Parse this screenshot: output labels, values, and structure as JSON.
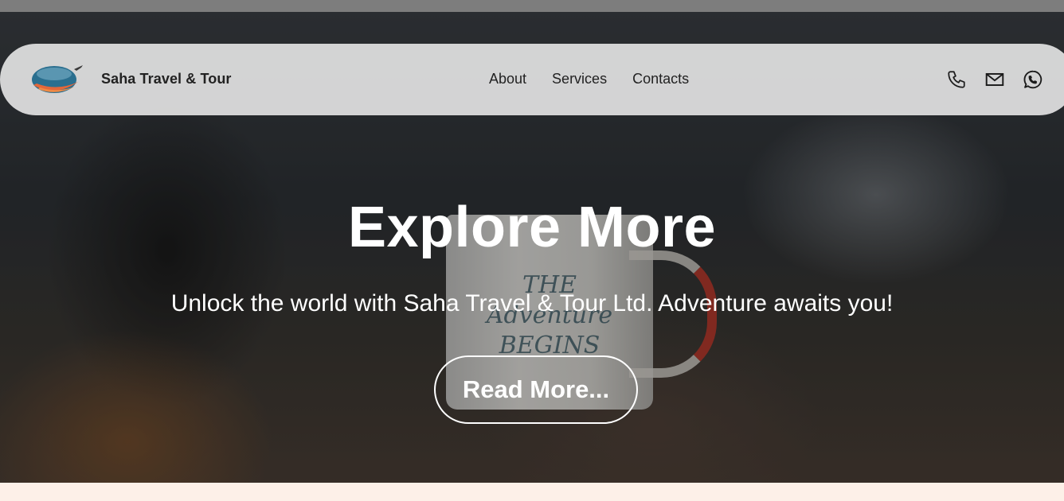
{
  "brand": {
    "name": "Saha Travel & Tour",
    "logo_icon": "globe-plane-logo"
  },
  "nav": {
    "links": [
      {
        "label": "About"
      },
      {
        "label": "Services"
      },
      {
        "label": "Contacts"
      }
    ],
    "icons": [
      "phone-icon",
      "mail-icon",
      "whatsapp-icon"
    ]
  },
  "hero": {
    "title": "Explore More",
    "subtitle": "Unlock the world with Saha Travel & Tour Ltd. Adventure awaits you!",
    "cta_label": "Read More...",
    "mug_text": "THE Adventure BEGINS"
  },
  "colors": {
    "top_strip": "#7d7d7d",
    "navbar_bg": "#f0f0f0",
    "text_dark": "#222222",
    "hero_text": "#ffffff",
    "bottom_band": "#fdf0e8",
    "logo_blue": "#2a6f8f",
    "logo_orange": "#e2673a"
  }
}
